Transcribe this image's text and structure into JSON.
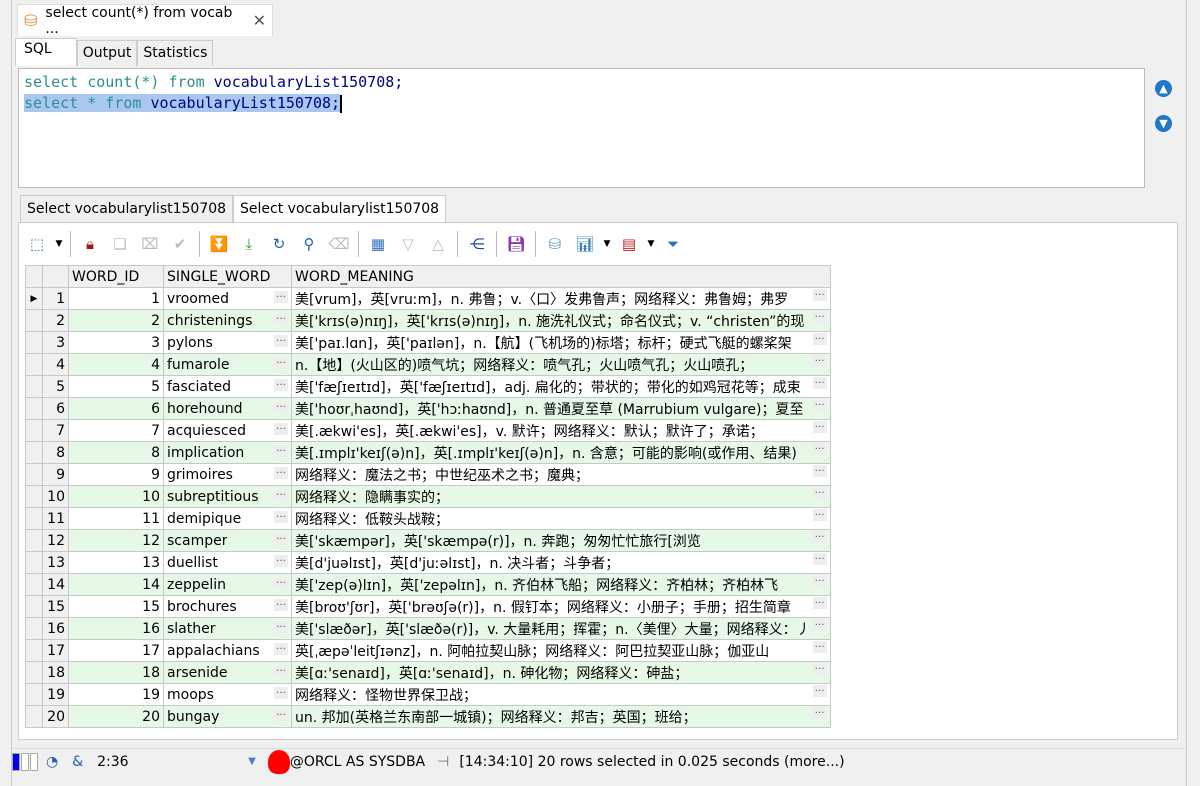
{
  "doc_tab": {
    "title": "select count(*) from vocab ...",
    "icon": "database-icon",
    "close": "✕"
  },
  "sub_tabs": [
    "SQL",
    "Output",
    "Statistics"
  ],
  "editor": {
    "line1": {
      "kw1": "select",
      "fn": "count(*)",
      "kw2": "from",
      "id": "vocabularyList150708;"
    },
    "line2": {
      "kw1": "select",
      "star": "*",
      "kw2": "from",
      "id": "vocabularyList150708;"
    }
  },
  "result_tabs": [
    "Select vocabularylist150708",
    "Select vocabularylist150708"
  ],
  "grid": {
    "columns": [
      "WORD_ID",
      "SINGLE_WORD",
      "WORD_MEANING"
    ],
    "rows": [
      [
        "1",
        "vroomed",
        "美[vrum]，英[vruːm]，n. 弗鲁；v.〈口〉发弗鲁声；网络释义：弗鲁姆；弗罗"
      ],
      [
        "2",
        "christenings",
        "美['krɪs(ə)nɪŋ]，英['krɪs(ə)nɪŋ]，n. 施洗礼仪式；命名仪式；v. “christen”的现"
      ],
      [
        "3",
        "pylons",
        "美['paɪ.lɑn]，英['paɪlən]，n.【航】(飞机场的)标塔；标杆；硬式飞艇的螺桨架"
      ],
      [
        "4",
        "fumarole",
        "n.【地】(火山区的)喷气坑；网络释义：喷气孔；火山喷气孔；火山喷孔；"
      ],
      [
        "5",
        "fasciated",
        "美['fæʃɪeɪtɪd]，英['fæʃɪeɪtɪd]，adj. 扁化的；带状的；带化的如鸡冠花等；成束"
      ],
      [
        "6",
        "horehound",
        "美['hoʊrˌhaʊnd]，英['hɔːhaʊnd]，n. 普通夏至草 (Marrubium vulgare)；夏至"
      ],
      [
        "7",
        "acquiesced",
        "美[.ækwi'es]，英[.ækwi'es]，v. 默许；网络释义：默认；默许了；承诺；"
      ],
      [
        "8",
        "implication",
        "美[.ɪmplɪ'keɪʃ(ə)n]，英[.ɪmplɪ'keɪʃ(ə)n]，n. 含意；可能的影响(或作用、结果)"
      ],
      [
        "9",
        "grimoires",
        "网络释义：魔法之书；中世纪巫术之书；魔典；"
      ],
      [
        "10",
        "subreptitious",
        "网络释义：隐瞒事实的；"
      ],
      [
        "11",
        "demipique",
        "网络释义：低鞍头战鞍；"
      ],
      [
        "12",
        "scamper",
        "美['skæmpər]，英['skæmpə(r)]，n. 奔跑；匆匆忙忙旅行[浏览"
      ],
      [
        "13",
        "duellist",
        "美[d'juəlɪst]，英[d'juːəlɪst]，n. 决斗者；斗争者；"
      ],
      [
        "14",
        "zeppelin",
        "美['zep(ə)lɪn]，英['zepəlɪn]，n. 齐伯林飞船；网络释义：齐柏林；齐柏林飞"
      ],
      [
        "15",
        "brochures",
        "美[broʊ'ʃʊr]，英['brəʊʃə(r)]，n. 假钉本；网络释义：小册子；手册；招生简章"
      ],
      [
        "16",
        "slather",
        "美['slæðər]，英['slæðə(r)]，v. 大量耗用；挥霍；n.〈美俚〉大量；网络释义：丿"
      ],
      [
        "17",
        "appalachians",
        "英[ˌæpəˈleitʃɪənz]，n. 阿帕拉契山脉；网络释义：阿巴拉契亚山脉；伽亚山"
      ],
      [
        "18",
        "arsenide",
        "美[ɑː'senaɪd]，英[ɑː'senaɪd]，n. 砷化物；网络释义：砷盐；"
      ],
      [
        "19",
        "moops",
        "网络释义：怪物世界保卫战；"
      ],
      [
        "20",
        "bungay",
        "un. 邦加(英格兰东南部一城镇)；网络释义：邦吉；英国；班给；"
      ]
    ]
  },
  "status": {
    "position": "2:36",
    "amp": "&",
    "connection": "@ORCL AS SYSDBA",
    "message": "[14:34:10]  20 rows selected in 0.025 seconds (more...)"
  },
  "colors": {
    "even_row": "#e6f9e6",
    "selection": "#a8c8ef",
    "keyword": "#2f8f8f",
    "identifier": "#000080"
  }
}
